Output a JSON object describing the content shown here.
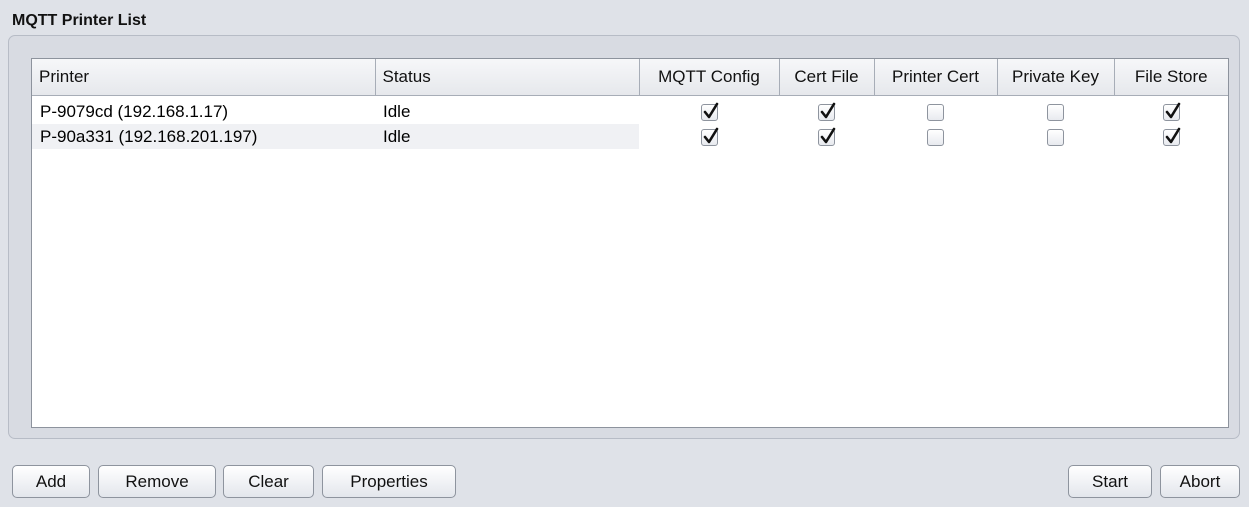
{
  "panel": {
    "title": "MQTT Printer List"
  },
  "table": {
    "columns": [
      "Printer",
      "Status",
      "MQTT Config",
      "Cert File",
      "Printer Cert",
      "Private Key",
      "File Store"
    ],
    "rows": [
      {
        "printer": "P-9079cd (192.168.1.17)",
        "status": "Idle",
        "mqtt_config": true,
        "cert_file": true,
        "printer_cert": false,
        "private_key": false,
        "file_store": true
      },
      {
        "printer": "P-90a331 (192.168.201.197)",
        "status": "Idle",
        "mqtt_config": true,
        "cert_file": true,
        "printer_cert": false,
        "private_key": false,
        "file_store": true
      }
    ]
  },
  "buttons": {
    "add": "Add",
    "remove": "Remove",
    "clear": "Clear",
    "properties": "Properties",
    "start": "Start",
    "abort": "Abort"
  },
  "icons": {
    "checkbox_checked": "checkmark-icon"
  }
}
